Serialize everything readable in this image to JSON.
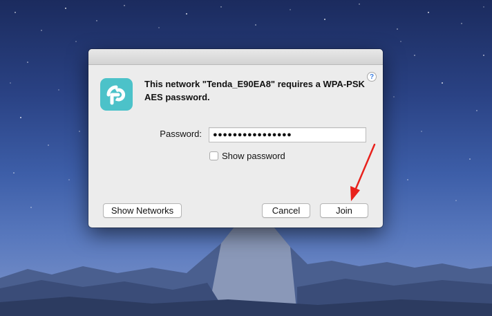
{
  "dialog": {
    "help_label": "?",
    "app_icon": "tp-link-icon",
    "message": "This network \"Tenda_E90EA8\" requires a WPA-PSK AES password.",
    "password_label": "Password:",
    "password_value": "●●●●●●●●●●●●●●●●",
    "show_password_label": "Show password",
    "show_password_checked": false,
    "buttons": {
      "show_networks": "Show Networks",
      "cancel": "Cancel",
      "join": "Join"
    }
  },
  "annotation": {
    "arrow_color": "#e8211c"
  },
  "colors": {
    "app_icon_bg": "#4cc2c9",
    "dialog_bg": "#ececec"
  }
}
